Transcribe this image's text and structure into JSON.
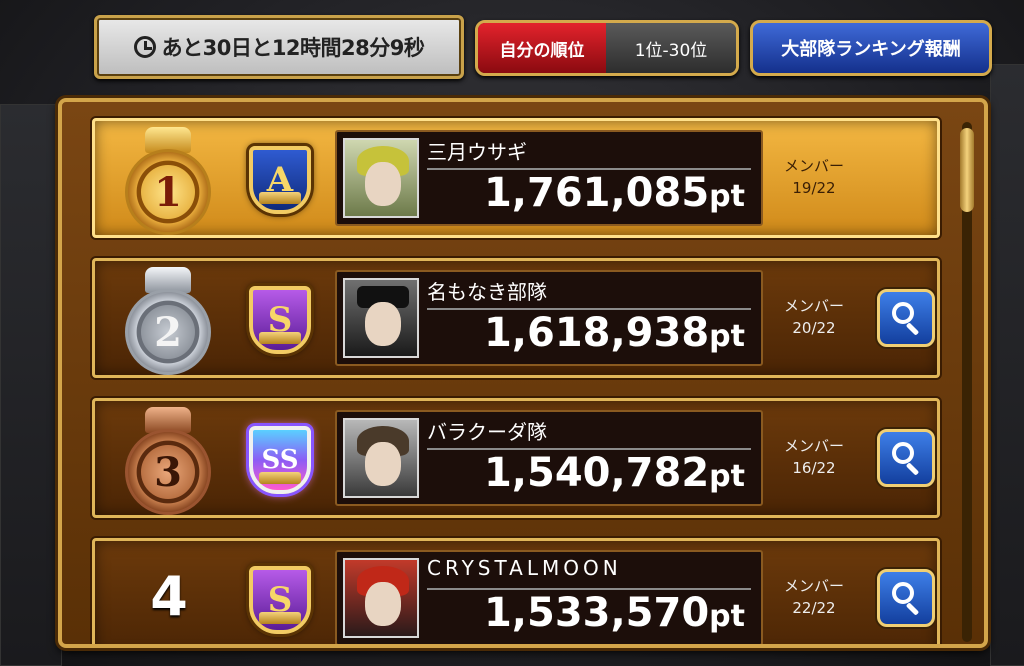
{
  "header": {
    "timer_text": "あと30日と12時間28分9秒",
    "my_rank_label": "自分の順位",
    "my_rank_value": "1位-30位",
    "reward_button_label": "大部隊ランキング報酬"
  },
  "rows": [
    {
      "rank": "1",
      "grade": "A",
      "team": "三月ウサギ",
      "points": "1,761,085",
      "unit": "pt",
      "members_label": "メンバー",
      "members": "19/22"
    },
    {
      "rank": "2",
      "grade": "S",
      "team": "名もなき部隊",
      "points": "1,618,938",
      "unit": "pt",
      "members_label": "メンバー",
      "members": "20/22"
    },
    {
      "rank": "3",
      "grade": "SS",
      "team": "バラクーダ隊",
      "points": "1,540,782",
      "unit": "pt",
      "members_label": "メンバー",
      "members": "16/22"
    },
    {
      "rank": "4",
      "grade": "S",
      "team": "CRYSTALMOON",
      "points": "1,533,570",
      "unit": "pt",
      "members_label": "メンバー",
      "members": "22/22"
    }
  ],
  "colors": {
    "accent_gold": "#d3a54a",
    "button_blue": "#2a55c8",
    "rank_red": "#c8161e"
  }
}
